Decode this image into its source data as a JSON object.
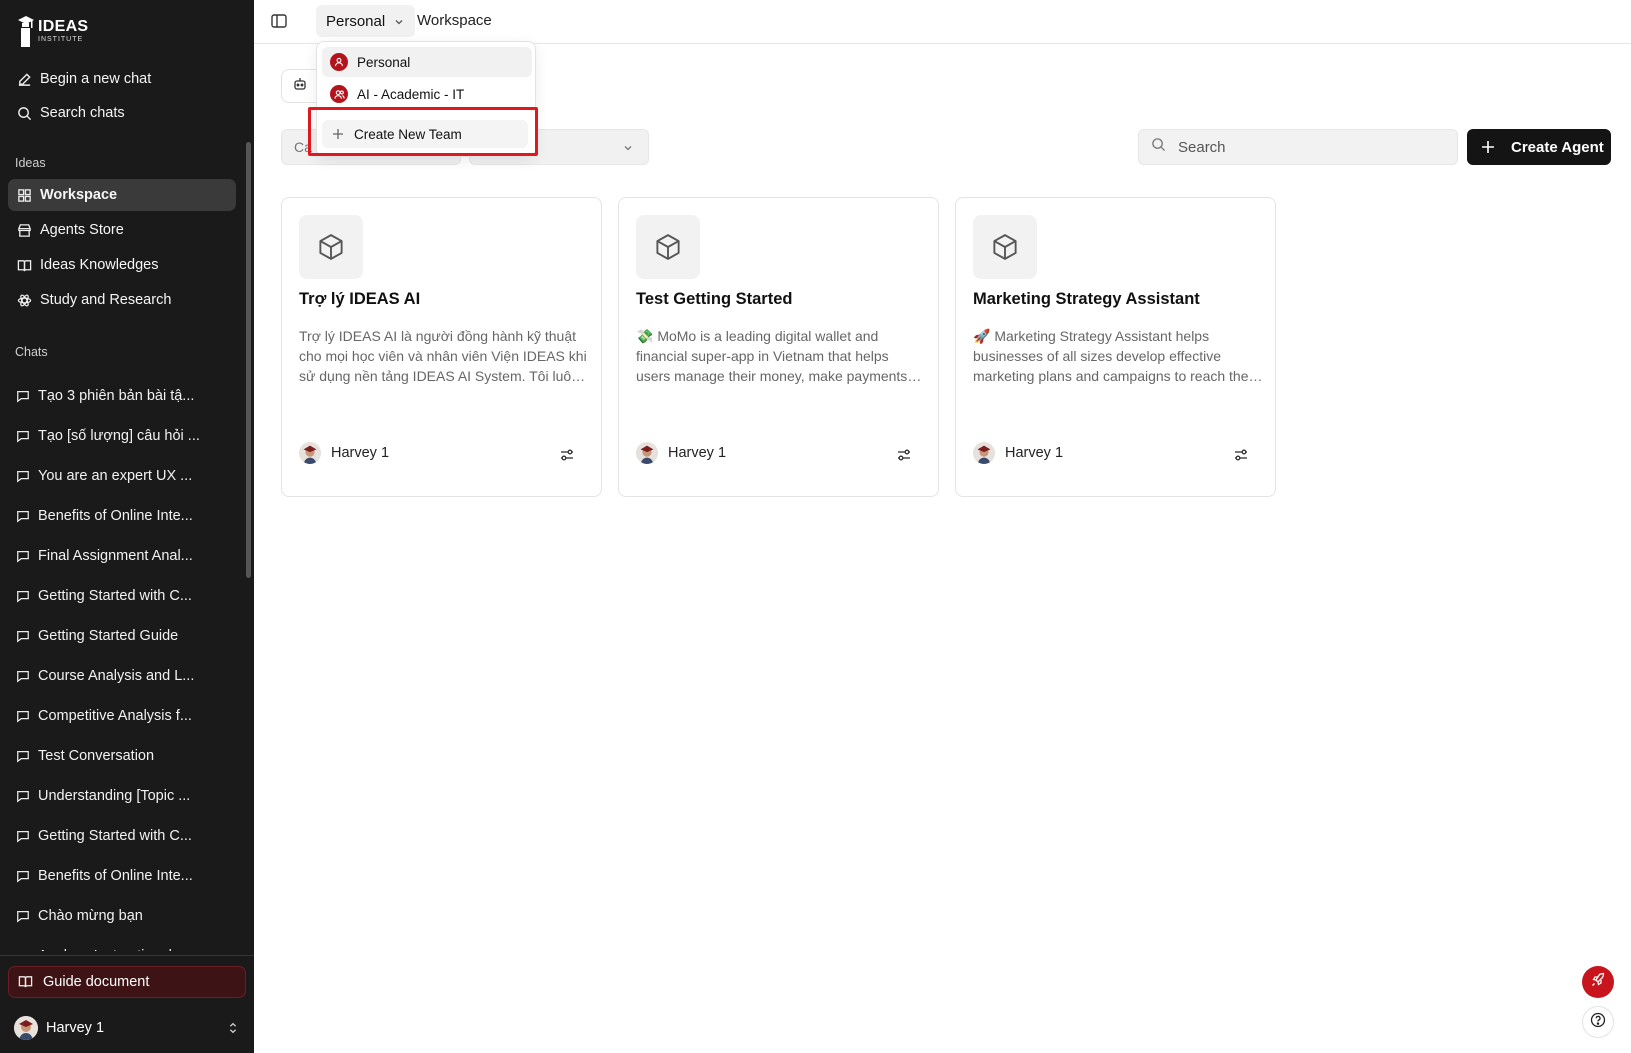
{
  "logo": {
    "line1": "IDEAS",
    "line2": "INSTITUTE"
  },
  "sidebar": {
    "top_items": [
      {
        "label": "Begin a new chat",
        "icon": "pencil-square-icon"
      },
      {
        "label": "Search chats",
        "icon": "search-icon"
      }
    ],
    "ideas_label": "Ideas",
    "ideas_items": [
      {
        "label": "Workspace",
        "icon": "grid-icon",
        "active": true
      },
      {
        "label": "Agents Store",
        "icon": "store-icon"
      },
      {
        "label": "Ideas Knowledges",
        "icon": "book-open-icon"
      },
      {
        "label": "Study and Research",
        "icon": "atom-icon"
      }
    ],
    "chats_label": "Chats",
    "chats": [
      "Tạo 3 phiên bản bài tậ...",
      "Tạo [số lượng] câu hỏi ...",
      "You are an expert UX ...",
      "Benefits of Online Inte...",
      "Final Assignment Anal...",
      "Getting Started with C...",
      "Getting Started Guide",
      "Course Analysis and L...",
      "Competitive Analysis f...",
      "Test Conversation",
      "Understanding [Topic ...",
      "Getting Started with C...",
      "Benefits of Online Inte...",
      "Chào mừng bạn",
      "Analyze Instructional ..."
    ],
    "guide": "Guide document",
    "user": "Harvey 1"
  },
  "topbar": {
    "team": "Personal",
    "breadcrumb": "Workspace"
  },
  "filters": {
    "category_placeholder": "Ca",
    "search_placeholder": "Search",
    "create_label": "Create Agent"
  },
  "dropdown": {
    "items": [
      {
        "label": "Personal",
        "icon": "user-icon",
        "selected": true
      },
      {
        "label": "AI - Academic - IT",
        "icon": "users-icon",
        "selected": false
      }
    ],
    "create_label": "Create New Team"
  },
  "cards": [
    {
      "title": "Trợ lý IDEAS AI",
      "description": "Trợ lý IDEAS AI là người đồng hành kỹ thuật cho mọi học viên và nhân viên Viện IDEAS khi sử dụng nền tảng IDEAS AI System. Tôi luôn sẵn sàng hỗ trợ bạn.",
      "author": "Harvey 1"
    },
    {
      "title": "Test Getting Started",
      "description": "💸 MoMo is a leading digital wallet and financial super-app in Vietnam that helps users manage their money, make payments and more.",
      "author": "Harvey 1"
    },
    {
      "title": "Marketing Strategy Assistant",
      "description": "🚀 Marketing Strategy Assistant helps businesses of all sizes develop effective marketing plans and campaigns to reach their audience.",
      "author": "Harvey 1"
    }
  ],
  "colors": {
    "sidebar_bg": "#1a1a1a",
    "accent_red": "#c8141c",
    "highlight": "#e0181f"
  }
}
